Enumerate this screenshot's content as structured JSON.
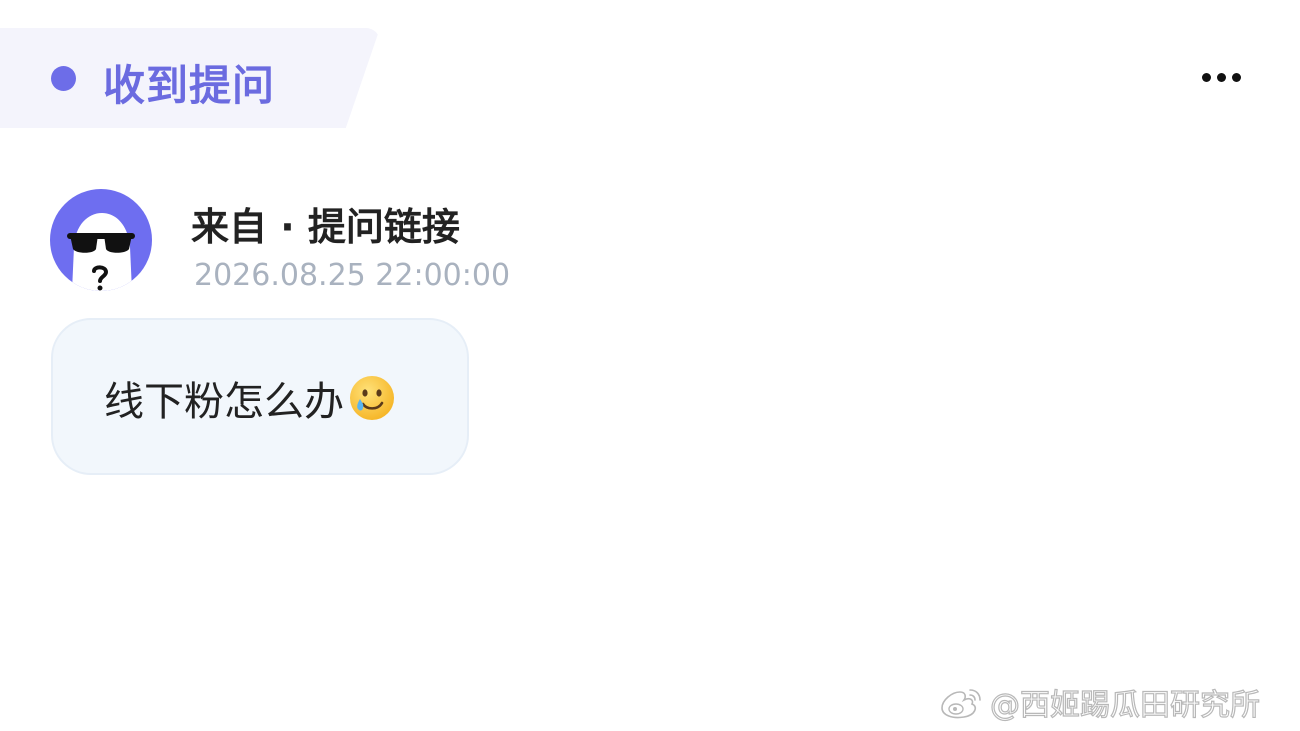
{
  "header": {
    "tag_label": "收到提问",
    "more_icon": "more-horizontal-icon"
  },
  "question": {
    "avatar_icon": "sunglasses-ghost-avatar",
    "source": "来自 · 提问链接",
    "timestamp": "2026.08.25 22:00:00",
    "text": "线下粉怎么办",
    "emoji_icon": "smiling-face-with-tear-icon"
  },
  "watermark": {
    "text": "@西姬踢瓜田研究所",
    "logo_icon": "weibo-logo-icon"
  },
  "colors": {
    "accent": "#6b6be0",
    "tag_background": "#f4f4fc",
    "bubble_background": "#f2f7fc",
    "timestamp": "#a9b2bf"
  }
}
